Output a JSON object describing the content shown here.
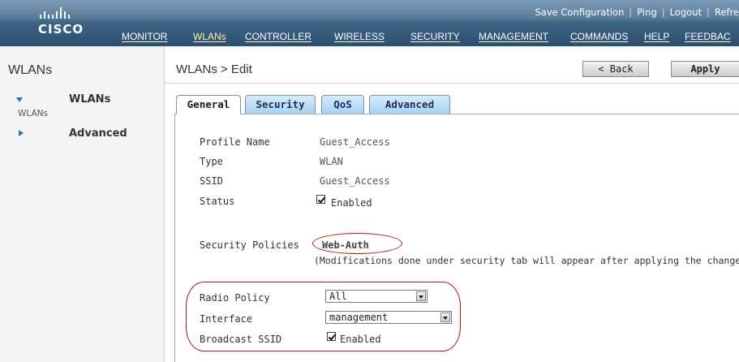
{
  "header": {
    "logo_text": "CISCO",
    "top_links": [
      "Save Configuration",
      "Ping",
      "Logout",
      "Refre"
    ],
    "nav": [
      "MONITOR",
      "WLANs",
      "CONTROLLER",
      "WIRELESS",
      "SECURITY",
      "MANAGEMENT",
      "COMMANDS",
      "HELP",
      "FEEDBAC"
    ],
    "active_nav": "WLANs"
  },
  "sidebar": {
    "title": "WLANs",
    "items": [
      {
        "label": "WLANs",
        "sub": "WLANs",
        "expanded": true
      },
      {
        "label": "Advanced",
        "expanded": false
      }
    ]
  },
  "main": {
    "title": "WLANs > Edit",
    "buttons": {
      "back": "< Back",
      "apply": "Apply"
    },
    "tabs": [
      {
        "label": "General",
        "active": true
      },
      {
        "label": "Security",
        "active": false
      },
      {
        "label": "QoS",
        "active": false
      },
      {
        "label": "Advanced",
        "active": false
      }
    ],
    "fields": {
      "profile_name": {
        "label": "Profile Name",
        "value": "Guest_Access"
      },
      "type": {
        "label": "Type",
        "value": "WLAN"
      },
      "ssid": {
        "label": "SSID",
        "value": "Guest_Access"
      },
      "status": {
        "label": "Status",
        "checkbox_label": "Enabled",
        "checked": true
      },
      "security_policies": {
        "label": "Security Policies",
        "value": "Web-Auth",
        "note": "(Modifications done under security tab will appear after applying the changes.)"
      },
      "radio_policy": {
        "label": "Radio Policy",
        "value": "All"
      },
      "interface": {
        "label": "Interface",
        "value": "management"
      },
      "broadcast_ssid": {
        "label": "Broadcast SSID",
        "checkbox_label": "Enabled",
        "checked": true
      }
    }
  },
  "colors": {
    "header_top": "#7d9bb6",
    "header_bottom": "#2b4f70",
    "active_nav": "#fff2a8",
    "highlight_ring": "#b01818",
    "tab_inactive": "#a9d1f2"
  }
}
